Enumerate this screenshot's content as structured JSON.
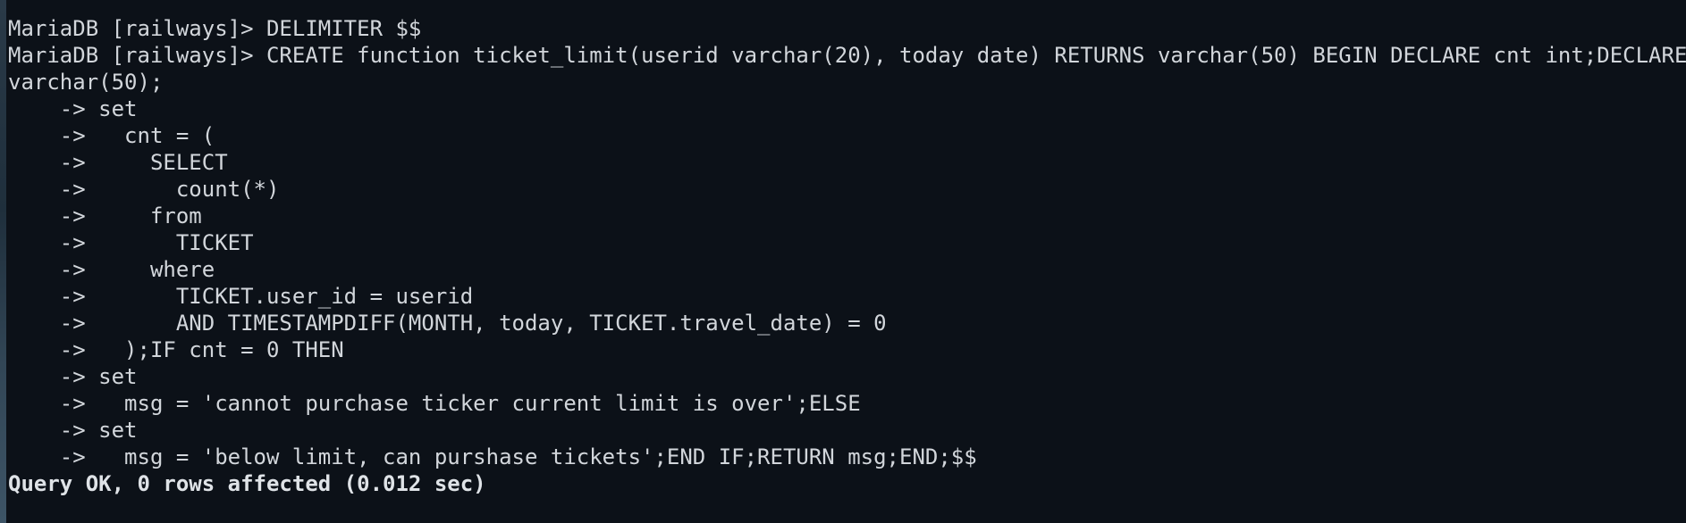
{
  "terminal": {
    "lines": [
      "MariaDB [railways]> DELIMITER $$",
      "MariaDB [railways]> CREATE function ticket_limit(userid varchar(20), today date) RETURNS varchar(50) BEGIN DECLARE cnt int;DECLARE msg",
      "varchar(50);",
      "    -> set",
      "    ->   cnt = (",
      "    ->     SELECT",
      "    ->       count(*)",
      "    ->     from",
      "    ->       TICKET",
      "    ->     where",
      "    ->       TICKET.user_id = userid",
      "    ->       AND TIMESTAMPDIFF(MONTH, today, TICKET.travel_date) = 0",
      "    ->   );IF cnt = 0 THEN",
      "    -> set",
      "    ->   msg = 'cannot purchase ticker current limit is over';ELSE",
      "    -> set",
      "    ->   msg = 'below limit, can purshase tickets';END IF;RETURN msg;END;$$"
    ],
    "result": "Query OK, 0 rows affected (0.012 sec)"
  }
}
